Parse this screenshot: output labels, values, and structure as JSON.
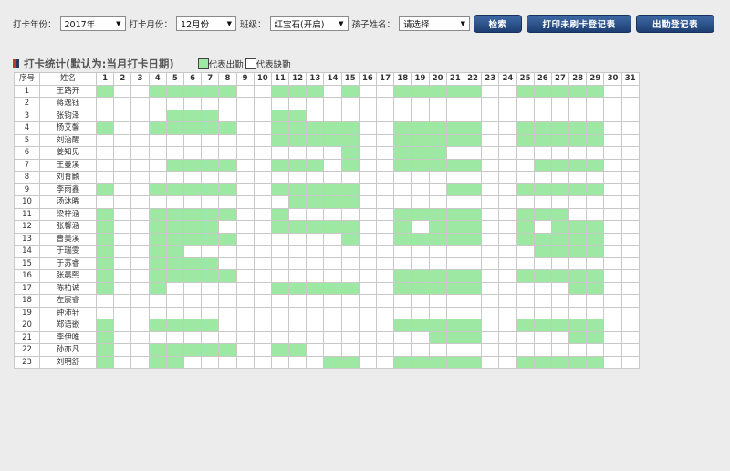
{
  "filters": {
    "year_label": "打卡年份：",
    "year_value": "2017年",
    "month_label": "打卡月份：",
    "month_value": "12月份",
    "class_label": "班级：",
    "class_value": "红宝石(开启)",
    "child_label": "孩子姓名：",
    "child_value": "请选择"
  },
  "buttons": {
    "search": "检索",
    "print": "打印未刷卡登记表",
    "attendance": "出勤登记表"
  },
  "section": {
    "title": "打卡统计(默认为:当月打卡日期)",
    "legend_present": "代表出勤",
    "legend_absent": "代表缺勤"
  },
  "colors": {
    "present": "#9de8a2",
    "absent": "#ffffff"
  },
  "table": {
    "col_index": "序号",
    "col_name": "姓名",
    "days": [
      "1",
      "2",
      "3",
      "4",
      "5",
      "6",
      "7",
      "8",
      "9",
      "10",
      "11",
      "12",
      "13",
      "14",
      "15",
      "16",
      "17",
      "18",
      "19",
      "20",
      "21",
      "22",
      "23",
      "24",
      "25",
      "26",
      "27",
      "28",
      "29",
      "30",
      "31"
    ],
    "rows": [
      {
        "n": "1",
        "name": "王路开",
        "att": [
          1,
          4,
          5,
          6,
          7,
          8,
          11,
          12,
          13,
          15,
          18,
          19,
          20,
          21,
          22,
          25,
          26,
          27,
          28,
          29
        ]
      },
      {
        "n": "2",
        "name": "蒋逸钰",
        "att": []
      },
      {
        "n": "3",
        "name": "张钧泽",
        "att": [
          5,
          6,
          7,
          11,
          12
        ]
      },
      {
        "n": "4",
        "name": "杨艾馨",
        "att": [
          1,
          4,
          5,
          6,
          7,
          8,
          11,
          12,
          13,
          14,
          15,
          18,
          19,
          20,
          21,
          22,
          25,
          26,
          27,
          28,
          29
        ]
      },
      {
        "n": "5",
        "name": "刘治醒",
        "att": [
          11,
          12,
          13,
          14,
          15,
          18,
          19,
          20,
          21,
          22,
          25,
          26,
          27,
          28,
          29
        ]
      },
      {
        "n": "6",
        "name": "姜知见",
        "att": [
          15,
          18,
          19,
          20
        ]
      },
      {
        "n": "7",
        "name": "王曼溪",
        "att": [
          5,
          6,
          7,
          8,
          11,
          12,
          13,
          15,
          18,
          19,
          20,
          21,
          22,
          26,
          27,
          28,
          29
        ]
      },
      {
        "n": "8",
        "name": "刘育麟",
        "att": []
      },
      {
        "n": "9",
        "name": "李雨鑫",
        "att": [
          1,
          4,
          5,
          6,
          7,
          8,
          11,
          12,
          13,
          14,
          15,
          21,
          22,
          25,
          26,
          27,
          28,
          29
        ]
      },
      {
        "n": "10",
        "name": "汤沐晞",
        "att": [
          12,
          13,
          14,
          15
        ]
      },
      {
        "n": "11",
        "name": "梁梓涵",
        "att": [
          1,
          4,
          5,
          6,
          7,
          8,
          11,
          18,
          19,
          20,
          21,
          22,
          25,
          26,
          27
        ]
      },
      {
        "n": "12",
        "name": "张馨涵",
        "att": [
          1,
          4,
          5,
          6,
          7,
          11,
          12,
          13,
          14,
          15,
          18,
          20,
          21,
          22,
          25,
          27,
          28,
          29
        ]
      },
      {
        "n": "13",
        "name": "曹美溪",
        "att": [
          1,
          4,
          5,
          6,
          7,
          8,
          15,
          18,
          19,
          20,
          21,
          22,
          25,
          26,
          27,
          28,
          29
        ]
      },
      {
        "n": "14",
        "name": "于瑞雯",
        "att": [
          1,
          4,
          5,
          26,
          27,
          28,
          29
        ]
      },
      {
        "n": "15",
        "name": "于苏睿",
        "att": [
          1,
          4,
          5,
          6,
          7
        ]
      },
      {
        "n": "16",
        "name": "张晨熙",
        "att": [
          1,
          4,
          5,
          6,
          7,
          8,
          18,
          19,
          20,
          21,
          22,
          25,
          26,
          27,
          28,
          29
        ]
      },
      {
        "n": "17",
        "name": "陈柏诚",
        "att": [
          1,
          4,
          11,
          12,
          13,
          14,
          15,
          18,
          19,
          20,
          21,
          22,
          28,
          29
        ]
      },
      {
        "n": "18",
        "name": "左宸睿",
        "att": []
      },
      {
        "n": "19",
        "name": "钟沛轩",
        "att": []
      },
      {
        "n": "20",
        "name": "郑语嵌",
        "att": [
          1,
          4,
          5,
          6,
          7,
          18,
          19,
          20,
          21,
          22,
          25,
          26,
          27,
          28,
          29
        ]
      },
      {
        "n": "21",
        "name": "李伊唯",
        "att": [
          1,
          20,
          21,
          22,
          28,
          29
        ]
      },
      {
        "n": "22",
        "name": "孙亦凡",
        "att": [
          1,
          4,
          5,
          6,
          7,
          8,
          11,
          12
        ]
      },
      {
        "n": "23",
        "name": "刘明舒",
        "att": [
          1,
          4,
          5,
          14,
          15,
          18,
          19,
          20,
          21,
          22,
          25,
          26,
          27,
          28,
          29
        ]
      }
    ]
  }
}
